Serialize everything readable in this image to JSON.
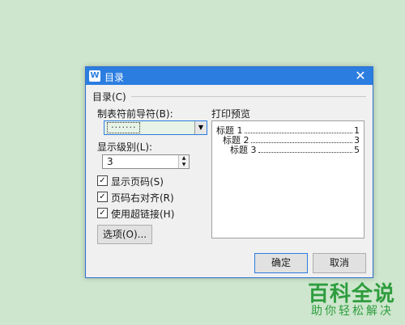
{
  "dialog": {
    "title": "目录",
    "group_label": "目录(C)",
    "leader_label": "制表符前导符(B):",
    "leader_value": "·······",
    "level_label": "显示级别(L):",
    "level_value": "3",
    "checkboxes": [
      {
        "label": "显示页码(S)",
        "checked": true
      },
      {
        "label": "页码右对齐(R)",
        "checked": true
      },
      {
        "label": "使用超链接(H)",
        "checked": true
      }
    ],
    "options_button": "选项(O)...",
    "preview_label": "打印预览",
    "preview_entries": [
      {
        "text": "标题 1",
        "page": "1"
      },
      {
        "text": "标题 2",
        "page": "3"
      },
      {
        "text": "标题 3",
        "page": "5"
      }
    ],
    "ok_button": "确定",
    "cancel_button": "取消"
  },
  "watermark": {
    "title": "百科全说",
    "subtitle": "助你轻松解决"
  },
  "colors": {
    "titlebar": "#2b7de0",
    "background": "#cde6cd",
    "watermark": "#2e9d3e"
  },
  "icons": [
    "wps-writer-icon",
    "close-icon",
    "dropdown-arrow-icon",
    "spin-up-icon",
    "spin-down-icon",
    "checkmark-icon"
  ]
}
